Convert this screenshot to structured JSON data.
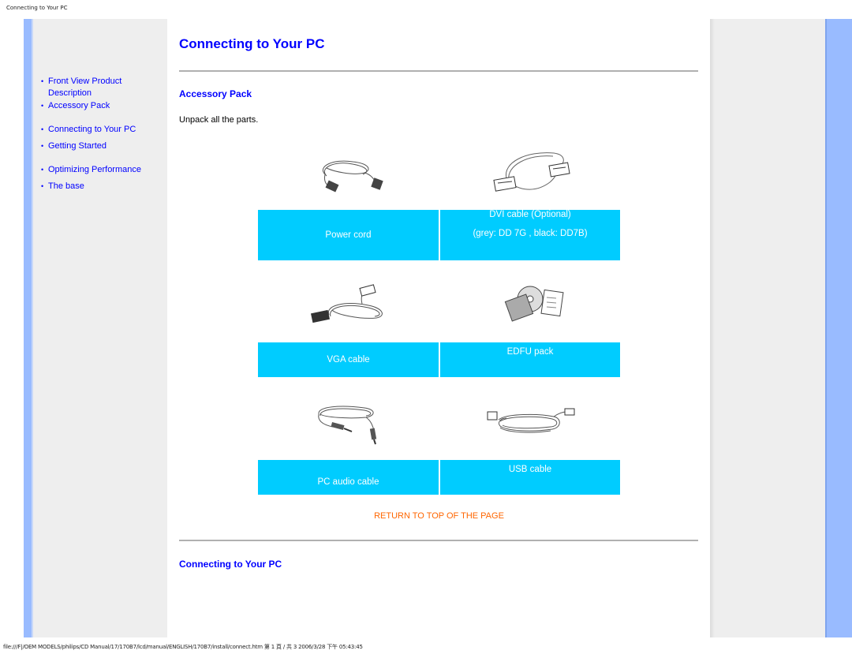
{
  "print_header": "Connecting to Your PC",
  "print_footer": "file:///F|/OEM MODELS/philips/CD Manual/17/170B7/lcd/manual/ENGLISH/170B7/install/connect.htm 第 1 頁 / 共 3 2006/3/28 下午 05:43:45",
  "sidebar": {
    "items": [
      {
        "label": "Front View Product Description"
      },
      {
        "label": "Accessory Pack"
      },
      {
        "label": "Connecting to Your PC"
      },
      {
        "label": "Getting Started"
      },
      {
        "label": "Optimizing Performance"
      },
      {
        "label": "The base"
      }
    ]
  },
  "main": {
    "title": "Connecting to Your PC",
    "accessory_heading": "Accessory Pack",
    "intro": "Unpack all the parts.",
    "accessories": [
      {
        "name": "Power cord",
        "icon": "power-cord-icon",
        "note": ""
      },
      {
        "name": "DVI cable (Optional)",
        "icon": "dvi-cable-icon",
        "note": "(grey: DD 7G , black: DD7B)"
      },
      {
        "name": "VGA cable",
        "icon": "vga-cable-icon",
        "note": ""
      },
      {
        "name": "EDFU pack",
        "icon": "edfu-pack-icon",
        "note": ""
      },
      {
        "name": "PC audio cable",
        "icon": "audio-cable-icon",
        "note": ""
      },
      {
        "name": "USB cable",
        "icon": "usb-cable-icon",
        "note": ""
      }
    ],
    "return_link": "RETURN TO TOP OF THE PAGE",
    "connect_heading": "Connecting to Your PC"
  },
  "colors": {
    "link": "#0000ff",
    "label_bg": "#00ccff",
    "return_link": "#ff6600",
    "side_strip": "#99bbff",
    "panel_bg": "#eeeeee"
  }
}
